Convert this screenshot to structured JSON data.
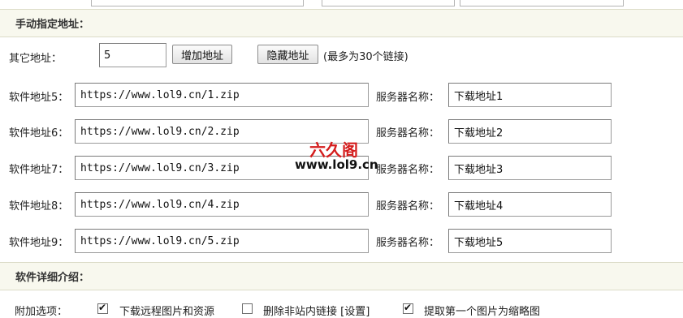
{
  "sections": {
    "manual_title": "手动指定地址：",
    "detail_title": "软件详细介绍："
  },
  "other_address": {
    "label": "其它地址：",
    "count_value": "5",
    "add_button": "增加地址",
    "hide_button": "隐藏地址",
    "max_note": "(最多为30个链接)"
  },
  "server_label": "服务器名称：",
  "rows": [
    {
      "label": "软件地址5：",
      "url": "https://www.lol9.cn/1.zip",
      "server": "下载地址1"
    },
    {
      "label": "软件地址6：",
      "url": "https://www.lol9.cn/2.zip",
      "server": "下载地址2"
    },
    {
      "label": "软件地址7：",
      "url": "https://www.lol9.cn/3.zip",
      "server": "下载地址3"
    },
    {
      "label": "软件地址8：",
      "url": "https://www.lol9.cn/4.zip",
      "server": "下载地址4"
    },
    {
      "label": "软件地址9：",
      "url": "https://www.lol9.cn/5.zip",
      "server": "下载地址5"
    }
  ],
  "watermark": {
    "text": "六久阁",
    "url": "www.lol9.cn",
    "color": "#d41c1c"
  },
  "extra_options": {
    "label": "附加选项：",
    "items": [
      {
        "text": "下载远程图片和资源",
        "checked": true
      },
      {
        "text": "删除非站内链接 [设置]",
        "checked": false
      },
      {
        "text": "提取第一个图片为缩略图",
        "checked": true
      }
    ]
  }
}
